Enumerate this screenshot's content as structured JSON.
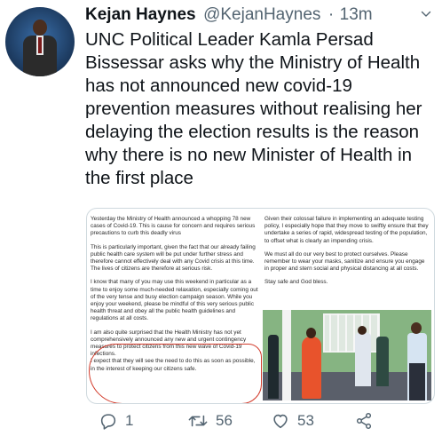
{
  "tweet": {
    "author_name": "Kejan Haynes",
    "author_handle": "@KejanHaynes",
    "separator": "·",
    "time": "13m",
    "text": "UNC Political Leader Kamla Persad Bissessar asks why the Ministry of Health has not announced new covid-19 prevention measures without realising her delaying the election results is the reason why there is no new Minister of Health in the first place"
  },
  "media": {
    "left_paragraphs": [
      "Yesterday the Ministry of Health announced a whopping 78 new cases of Covid-19. This is cause for concern and requires serious precautions to curb this deadly virus",
      "This is particularly important, given the fact that our already failing public health care system will be put under further stress and therefore cannot effectively deal with any Covid crisis at this time. The lives of citizens are therefore at serious risk.",
      "I know that many of you may use this weekend in particular as a time to enjoy some much-needed relaxation, especially coming out of the very tense and busy election campaign season. While you enjoy your weekend, please be mindful of this very serious public health threat and obey all the public health guidelines and regulations at all costs.",
      "I am also quite surprised that the Health Ministry has not yet comprehensively announced any new and urgent contingency measures to protect citizens from this new wave of Covid-19 infections.\nI expect that they will see the need to do this as soon as possible, in the interest of keeping our citizens safe."
    ],
    "right_paragraphs": [
      "Given their colossal failure in implementing an adequate testing policy, I especially hope that they move to swiftly ensure that they undertake a series of rapid, widespread testing of the population, to offset what is clearly an impending crisis.",
      "We must all do our very best to protect ourselves. Please remember to wear your masks, sanitize and ensure you engage in proper and stern social and physical distancing at all costs.",
      "Stay safe and God bless."
    ]
  },
  "actions": {
    "replies": "1",
    "retweets": "56",
    "likes": "53"
  },
  "icons": {
    "reply": "reply-icon",
    "retweet": "retweet-icon",
    "like": "heart-icon",
    "share": "share-icon",
    "menu": "chevron-down-icon"
  },
  "colors": {
    "text": "#0f1419",
    "muted": "#536471",
    "annotation": "#d23a2a"
  }
}
